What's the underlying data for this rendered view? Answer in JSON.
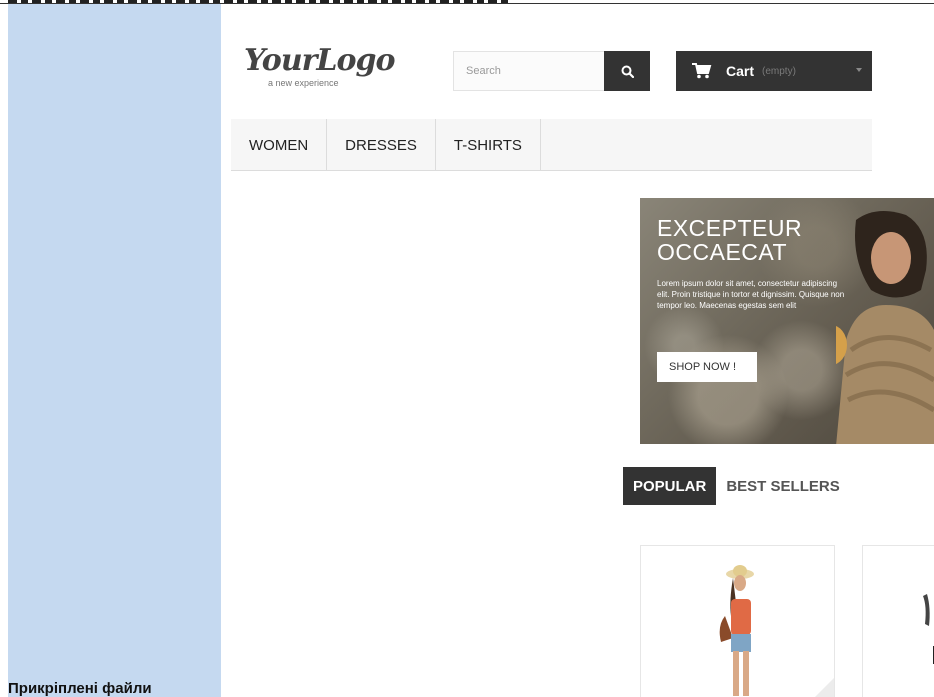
{
  "store": {
    "logo_text": "YourLogo",
    "logo_tagline": "a new experience"
  },
  "search": {
    "placeholder": "Search"
  },
  "cart": {
    "label": "Cart",
    "status": "(empty)"
  },
  "nav": {
    "items": [
      "WOMEN",
      "DRESSES",
      "T-SHIRTS"
    ]
  },
  "banner": {
    "heading_line1": "EXCEPTEUR",
    "heading_line2": "OCCAECAT",
    "copy": "Lorem ipsum dolor sit amet, consectetur adipiscing elit. Proin tristique in tortor et dignissim. Quisque non tempor leo. Maecenas egestas sem elit",
    "button_label": "SHOP NOW !"
  },
  "tabs": {
    "popular": "POPULAR",
    "best_sellers": "BEST SELLERS"
  },
  "sidebar": {
    "attached_files_label": "Прикріплені файли"
  },
  "colors": {
    "sidebar_bg": "#c5d9f0",
    "dark": "#333333",
    "nav_bg": "#f6f6f6"
  }
}
